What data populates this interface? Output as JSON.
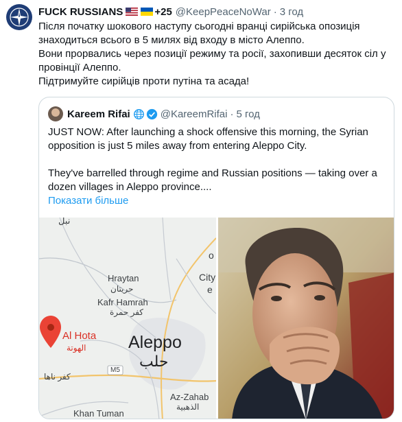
{
  "tweet": {
    "author_name": "FUCK RUSSIANS",
    "badge_count": "+25",
    "handle": "@KeepPeaceNoWar",
    "separator": "·",
    "time": "3 год",
    "lines": [
      "Після початку шокового наступу сьогодні вранці сирійська опозиція",
      "знаходиться всього в 5 милях від входу в місто Алеппо.",
      "Вони прорвались через позиції режиму та росії, захопивши десяток сіл у",
      "провінції Алеппо.",
      "Підтримуйте сирійців проти путіна та асада!"
    ],
    "icons": [
      "nato-emblem-icon",
      "us-flag-icon",
      "ukraine-flag-icon"
    ]
  },
  "quote": {
    "author_name": "Kareem Rifai",
    "handle": "@KareemRifai",
    "separator": "·",
    "time": "5 год",
    "paragraph1": [
      "JUST NOW: After launching a shock offensive this morning, the Syrian",
      "opposition is just 5 miles away from entering Aleppo City."
    ],
    "paragraph2": [
      "They've barrelled through regime and Russian positions — taking over a",
      "dozen villages in Aleppo province...."
    ],
    "show_more": "Показати більше",
    "icons": [
      "globe-icon",
      "verified-icon"
    ]
  },
  "map": {
    "labels": {
      "top_arabic": "نبل",
      "hraytan": "Hraytan",
      "hraytan_ar": "حريتان",
      "kafr_hamrah": "Kafr Hamrah",
      "kafr_hamrah_ar": "كفر حمرة",
      "al_hota": "Al Hota",
      "al_hota_ar": "الهوتة",
      "aleppo": "Aleppo",
      "aleppo_ar": "حلب",
      "kafr_naha_ar": "كفر ناها",
      "m5": "M5",
      "az_zahab": "Az-Zahab",
      "az_zahab_ar": "الذهبية",
      "khan_tuman": "Khan Tuman",
      "city_fragment_1": "o",
      "city_fragment_2": "City",
      "city_fragment_3": "e"
    }
  },
  "colors": {
    "accent": "#1d9bf0",
    "secondary_text": "#536471",
    "border": "#cfd9de",
    "map_pin": "#ea4335"
  }
}
